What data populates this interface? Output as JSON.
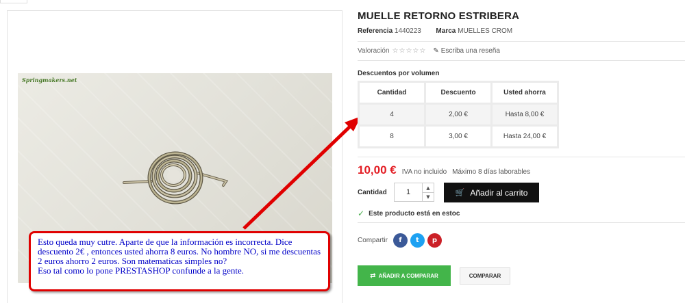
{
  "product": {
    "title": "MUELLE RETORNO ESTRIBERA",
    "reference_label": "Referencia",
    "reference_value": "1440223",
    "brand_label": "Marca",
    "brand_value": "MUELLES CROM",
    "image_logo": "Springmakers.net"
  },
  "rating": {
    "label": "Valoración",
    "stars": "☆☆☆☆☆",
    "review_link": "Escriba una reseña",
    "review_icon": "pencil-icon"
  },
  "discounts": {
    "title": "Descuentos por volumen",
    "headers": [
      "Cantidad",
      "Descuento",
      "Usted ahorra"
    ],
    "rows": [
      [
        "4",
        "2,00 €",
        "Hasta 8,00 €"
      ],
      [
        "8",
        "3,00 €",
        "Hasta 24,00 €"
      ]
    ]
  },
  "price": {
    "value": "10,00 €",
    "tax_note": "IVA no incluido",
    "delivery": "Máximo 8 días laborables",
    "color": "#e31e25"
  },
  "cart": {
    "qty_label": "Cantidad",
    "qty_value": "1",
    "add_label": "Añadir al carrito",
    "cart_icon": "cart-icon"
  },
  "stock": {
    "text": "Este producto está en estoc"
  },
  "share": {
    "label": "Compartir",
    "networks": [
      {
        "name": "facebook",
        "glyph": "f",
        "color": "#3b5998"
      },
      {
        "name": "twitter",
        "glyph": "t",
        "color": "#1da1f2"
      },
      {
        "name": "pinterest",
        "glyph": "p",
        "color": "#cb2027"
      }
    ]
  },
  "compare": {
    "add_label": "AÑADIR A COMPARAR",
    "label": "COMPARAR",
    "add_color": "#43b54a"
  },
  "annotation": {
    "lines": [
      "Esto queda muy cutre. Aparte de que la información es incorrecta. Dice",
      "descuento 2€ , entonces usted ahorra 8 euros. No hombre NO, si me descuentas",
      "2 euros ahorro 2 euros. Son matematicas simples no?",
      "Eso tal como lo pone PRESTASHOP confunde a la gente."
    ],
    "border_color": "#e00000",
    "text_color": "#0000c8"
  }
}
